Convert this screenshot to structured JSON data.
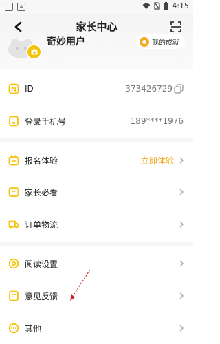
{
  "status_bar": {
    "left_icons": [
      "notification-box-icon",
      "app-a-icon"
    ],
    "left_box_label": "A",
    "time": "4:15"
  },
  "header": {
    "title": "家长中心",
    "username": "奇妙用户",
    "achievement_label": "我的成就"
  },
  "rows": {
    "id": {
      "label": "ID",
      "value": "373426729"
    },
    "phone": {
      "label": "登录手机号",
      "value": "189****1976"
    },
    "signup": {
      "label": "报名体验",
      "value": "立即体验"
    },
    "parent_must_read": {
      "label": "家长必看"
    },
    "order_logistics": {
      "label": "订单物流"
    },
    "reading_settings": {
      "label": "阅读设置"
    },
    "feedback": {
      "label": "意见反馈"
    },
    "other": {
      "label": "其他"
    }
  },
  "colors": {
    "accent": "#f5a51d",
    "icon_yellow": "#f6c30c",
    "text": "#222222",
    "muted": "#777777"
  }
}
